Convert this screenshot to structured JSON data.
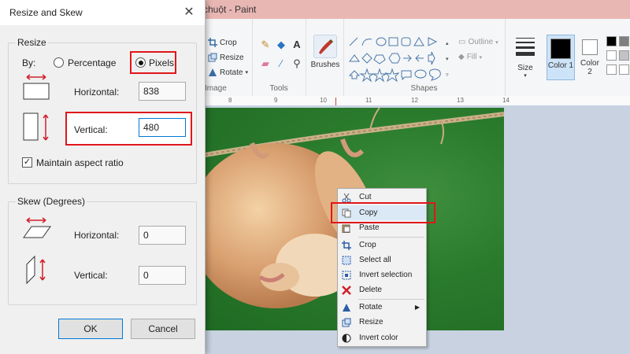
{
  "paint": {
    "title": "chuột - Paint",
    "image_group": {
      "crop_label": "Crop",
      "resize_label": "Resize",
      "rotate_label": "Rotate",
      "group_label": "Image"
    },
    "tools_label": "Tools",
    "brushes_label": "Brushes",
    "shapes": {
      "outline_label": "Outline",
      "fill_label": "Fill",
      "group_label": "Shapes"
    },
    "size_label": "Size",
    "color1_label": "Color 1",
    "color2_label": "Color 2",
    "ruler_ticks": [
      "8",
      "9",
      "10",
      "11",
      "12",
      "13",
      "14"
    ]
  },
  "dialog": {
    "title": "Resize and Skew",
    "resize_legend": "Resize",
    "by_label": "By:",
    "percentage_label": "Percentage",
    "pixels_label": "Pixels",
    "selected_mode": "Pixels",
    "horizontal_label": "Horizontal:",
    "horizontal_value": "838",
    "vertical_label": "Vertical:",
    "vertical_value": "480",
    "maintain_label": "Maintain aspect ratio",
    "maintain_checked": true,
    "skew_legend": "Skew (Degrees)",
    "skew_horizontal_label": "Horizontal:",
    "skew_horizontal_value": "0",
    "skew_vertical_label": "Vertical:",
    "skew_vertical_value": "0",
    "ok_label": "OK",
    "cancel_label": "Cancel"
  },
  "context_menu": {
    "items": [
      {
        "label": "Cut",
        "icon": "scissors-icon"
      },
      {
        "label": "Copy",
        "icon": "copy-icon",
        "highlighted": true
      },
      {
        "label": "Paste",
        "icon": "paste-icon"
      },
      {
        "label": "Crop",
        "icon": "crop-icon"
      },
      {
        "label": "Select all",
        "icon": "select-all-icon"
      },
      {
        "label": "Invert selection",
        "icon": "invert-selection-icon"
      },
      {
        "label": "Delete",
        "icon": "delete-icon"
      },
      {
        "label": "Rotate",
        "icon": "rotate-icon",
        "submenu": true
      },
      {
        "label": "Resize",
        "icon": "resize-icon"
      },
      {
        "label": "Invert color",
        "icon": "invert-color-icon"
      }
    ]
  },
  "colors": {
    "highlight_red": "#e0161a",
    "title_bar": "#e9b7b3",
    "image_green": "#2a7a2c"
  }
}
